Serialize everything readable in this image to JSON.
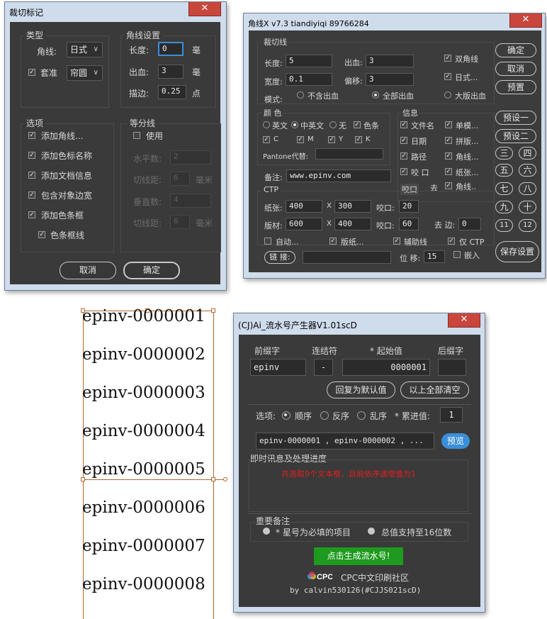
{
  "dialog1": {
    "title": "裁切标记",
    "close": "✕",
    "type_group": "类型",
    "corner_label": "角线:",
    "corner_value": "日式",
    "register_label": "套准",
    "register_value": "帘圆",
    "corner_settings_group": "角线设置",
    "length_label": "长度:",
    "length_value": "0",
    "length_unit": "毫",
    "bleed_label": "出血:",
    "bleed_value": "3",
    "bleed_unit": "毫",
    "stroke_label": "描边:",
    "stroke_value": "0.25",
    "stroke_unit": "点",
    "options_group": "选项",
    "options": [
      "添加角线...",
      "添加色标名称",
      "添加文档信息",
      "包含对象边宽",
      "添加色条框",
      "色条框线"
    ],
    "divide_group": "等分线",
    "use_label": "使用",
    "h_count": "水平数:",
    "h_count_value": "2",
    "cut_dist": "切线距:",
    "cut_dist_value": "6",
    "mm": "毫米",
    "v_count": "垂直数:",
    "v_count_value": "4",
    "cut_dist2": "切线距:",
    "cut_dist2_value": "6",
    "mm2": "毫米",
    "cancel": "取消",
    "ok": "确定"
  },
  "dialog2": {
    "title": "角线X v7.3 tiandiyiqi 89766284",
    "close": "✕",
    "cut_group": "裁切线",
    "length_label": "长度:",
    "length_value": "5",
    "bleed_label": "出血:",
    "bleed_value": "3",
    "double_corner": "双角线",
    "width_label": "宽度:",
    "width_value": "0.1",
    "offset_label": "偏移:",
    "offset_value": "3",
    "japanese": "日式...",
    "mode_label": "模式:",
    "no_bleed": "不含出血",
    "all_bleed": "全部出血",
    "big_bleed": "大版出血",
    "color_group": "颜 色",
    "c_en": "英文",
    "c_cnen": "中英文",
    "c_none": "无",
    "c_bar": "色条",
    "cmyk": [
      "C",
      "M",
      "Y",
      "K"
    ],
    "pantone_label": "Pantone代替:",
    "info_group": "信息",
    "info_items": [
      "文件名",
      "单模...",
      "日期",
      "拼版...",
      "路径",
      "角线...",
      "咬 口",
      "纸张...",
      "角线.."
    ],
    "bite": "咬口",
    "go": "去",
    "note_label": "备注:",
    "note_value": "www.epinv.com",
    "ctp_group": "CTP",
    "paper_label": "纸张:",
    "paper_w": "400",
    "paper_h": "300",
    "x": "X",
    "bite_label": "咬口:",
    "bite_value": "20",
    "plate_label": "版材:",
    "plate_w": "600",
    "plate_h": "400",
    "bite_label2": "咬口:",
    "bite_value2": "60",
    "remove_edge": "去 边:",
    "remove_edge_value": "0",
    "auto": "自动...",
    "plate_paper": "版纸...",
    "aux_line": "辅助线",
    "only_ctp": "仅 CTP",
    "link": "链 接:",
    "shift_label": "位 移:",
    "shift_value": "15",
    "embed": "嵌入",
    "btn_ok": "确定",
    "btn_cancel": "取消",
    "btn_preset": "预置",
    "btn_p1": "预设一",
    "btn_p2": "预设二",
    "num_btns": [
      "三",
      "四",
      "五",
      "六",
      "七",
      "八",
      "九",
      "十",
      "11",
      "12"
    ],
    "save": "保存设置"
  },
  "serials": [
    "epinv-0000001",
    "epinv-0000002",
    "epinv-0000003",
    "epinv-0000004",
    "epinv-0000005",
    "epinv-0000006",
    "epinv-0000007",
    "epinv-0000008"
  ],
  "dialog3": {
    "title": "(CJ)Ai_流水号产生器V1.01scD",
    "close": "✕",
    "prefix_label": "前缀字",
    "connector_label": "连结符",
    "start_label": "* 起始值",
    "suffix_label": "后缀字",
    "prefix_value": "epinv",
    "connector_value": "-",
    "start_value": "0000001",
    "suffix_value": "",
    "reset": "回复为默认值",
    "clear_all": "以上全部清空",
    "option_label": "选项:",
    "order": "顺序",
    "reverse": "反序",
    "random": "乱序",
    "step_label": "* 累进值:",
    "step_value": "1",
    "preview_text": "epinv-0000001 , epinv-0000002 , ...",
    "preview_btn": "预览",
    "progress_group": "即时讯息及处理进度",
    "progress_msg": "共选取9个文本框，目前依序递增值为1",
    "notes_group": "重要备注",
    "note1": "* 星号为必填的项目",
    "note2": "总值支持至16位数",
    "generate": "点击生成流水号!",
    "cpc_logo": "CPC",
    "cpc_name": "CPC中文印刷社区",
    "byline": "by calvin530126(#CJJS021scD)"
  },
  "colors": {
    "accent_blue": "#3a8fd8",
    "green_button": "#1e9a1e",
    "red_text": "#e02020",
    "close_red": "#c9463d"
  }
}
